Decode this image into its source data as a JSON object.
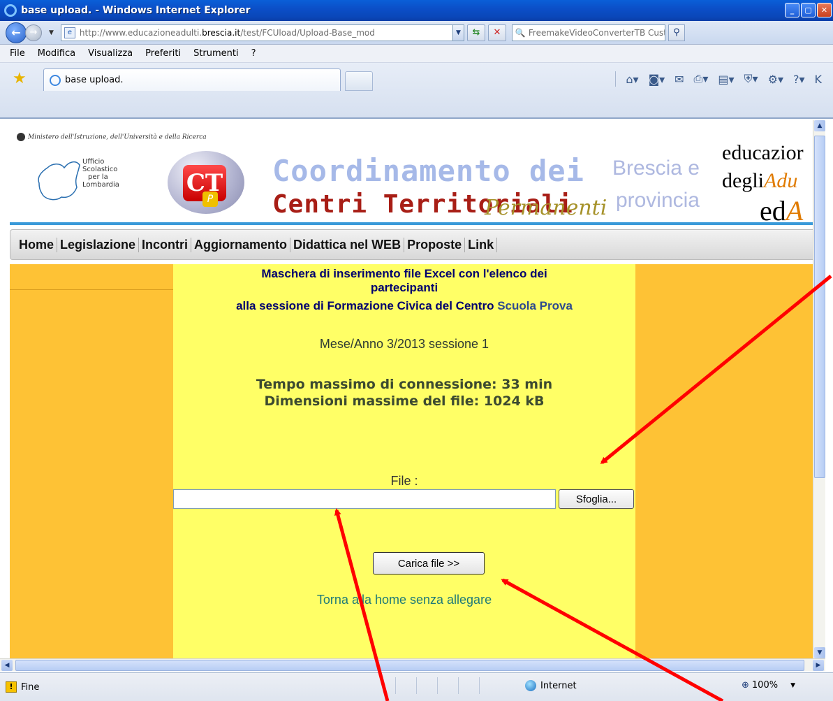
{
  "window": {
    "title": "base upload. - Windows Internet Explorer",
    "buttons": [
      "_",
      "▢",
      "✕"
    ]
  },
  "address_bar": {
    "url_prefix": "http://www.educazioneadulti.",
    "url_domain": "brescia.it",
    "url_suffix": "/test/FCUload/Upload-Base_mod",
    "search_text": "FreemakeVideoConverterTB Customized Web Se"
  },
  "menu": [
    "File",
    "Modifica",
    "Visualizza",
    "Preferiti",
    "Strumenti",
    "?"
  ],
  "tab": {
    "label": "base upload."
  },
  "site_header": {
    "ministry": "Ministero dell'Istruzione, dell'Università e della Ricerca",
    "office_lines": [
      "Ufficio",
      "Scolastico",
      "per la",
      "Lombardia"
    ],
    "logo_letters": "CT",
    "logo_p": "P",
    "title_line1": "Coordinamento dei",
    "title_line2": "Centri Territoriali",
    "title_script": "Permanenti",
    "region_line1": "Brescia e",
    "region_line2": "provincia",
    "eda_line1": "educazior",
    "eda_line2_plain": "degli",
    "eda_line2_italic": "Adu",
    "eda_line3_plain": "ed",
    "eda_line3_italic": "A"
  },
  "nav": [
    "Home",
    "Legislazione",
    "Incontri",
    "Aggiornamento",
    "Didattica nel WEB",
    "Proposte",
    "Link"
  ],
  "form": {
    "heading_line1": "Maschera di inserimento file Excel con l'elenco dei",
    "heading_line2": "partecipanti",
    "heading_line3": "alla sessione di Formazione Civica del Centro",
    "school_name": "Scuola Prova",
    "period": "Mese/Anno 3/2013 sessione 1",
    "max_time": "Tempo massimo di connessione: 33 min",
    "max_size": "Dimensioni massime del file: 1024 kB",
    "file_label": "File :",
    "file_value": "",
    "browse_label": "Sfoglia...",
    "upload_label": "Carica file >>",
    "home_link": "Torna alla home senza allegare"
  },
  "status_bar": {
    "status": "Fine",
    "zone": "Internet",
    "zoom": "100%"
  },
  "colors": {
    "sidebar": "#fec235",
    "main": "#ffff66",
    "annotation": "#ff0000"
  }
}
